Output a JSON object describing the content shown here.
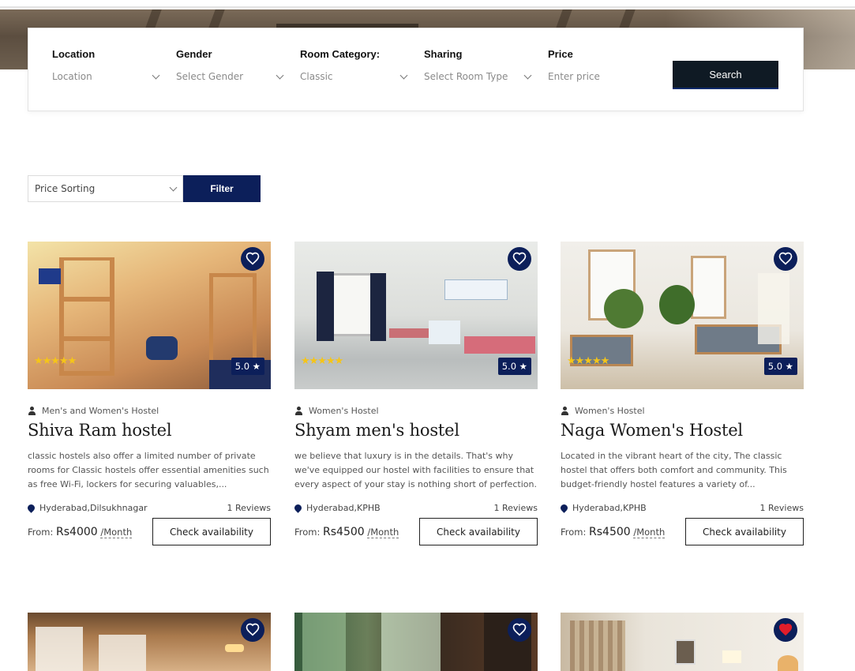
{
  "search": {
    "fields": [
      {
        "label": "Location",
        "value": "Location"
      },
      {
        "label": "Gender",
        "value": "Select Gender"
      },
      {
        "label": "Room Category:",
        "value": "Classic"
      },
      {
        "label": "Sharing",
        "value": "Select Room Type"
      },
      {
        "label": "Price",
        "placeholder": "Enter price"
      }
    ],
    "button": "Search"
  },
  "toolbar": {
    "sort_value": "Price Sorting",
    "filter_label": "Filter"
  },
  "cards": [
    {
      "type": "Men's and Women's Hostel",
      "title": "Shiva Ram hostel",
      "description": "classic hostels also offer a limited number of private rooms for Classic hostels offer essential amenities such as free Wi-Fi, lockers for securing valuables,...",
      "location": "Hyderabad,Dilsukhnagar",
      "reviews": "1 Reviews",
      "rating": "5.0 ★",
      "stars": "★★★★★",
      "price_prefix": "From:",
      "price": "Rs4000",
      "period": "/Month",
      "cta": "Check availability"
    },
    {
      "type": "Women's Hostel",
      "title": "Shyam men's hostel",
      "description": "we believe that luxury is in the details. That's why we've equipped our hostel with facilities to ensure that every aspect of your stay is nothing short of perfection. Fro...",
      "location": "Hyderabad,KPHB",
      "reviews": "1 Reviews",
      "rating": "5.0 ★",
      "stars": "★★★★★",
      "price_prefix": "From:",
      "price": "Rs4500",
      "period": "/Month",
      "cta": "Check availability"
    },
    {
      "type": "Women's Hostel",
      "title": "Naga Women's Hostel",
      "description": "Located in the vibrant heart of the city, The classic hostel that offers both comfort and community. This budget-friendly hostel features a variety of...",
      "location": "Hyderabad,KPHB",
      "reviews": "1 Reviews",
      "rating": "5.0 ★",
      "stars": "★★★★★",
      "price_prefix": "From:",
      "price": "Rs4500",
      "period": "/Month",
      "cta": "Check availability"
    }
  ],
  "colors": {
    "navy": "#0c1f5a",
    "dark_button": "#0f1a24",
    "star": "#f5c518",
    "favorite_red": "#e11d2a"
  },
  "icons": [
    "heart-icon",
    "person-icon",
    "location-pin-icon",
    "chevron-down-icon",
    "star-icon"
  ]
}
